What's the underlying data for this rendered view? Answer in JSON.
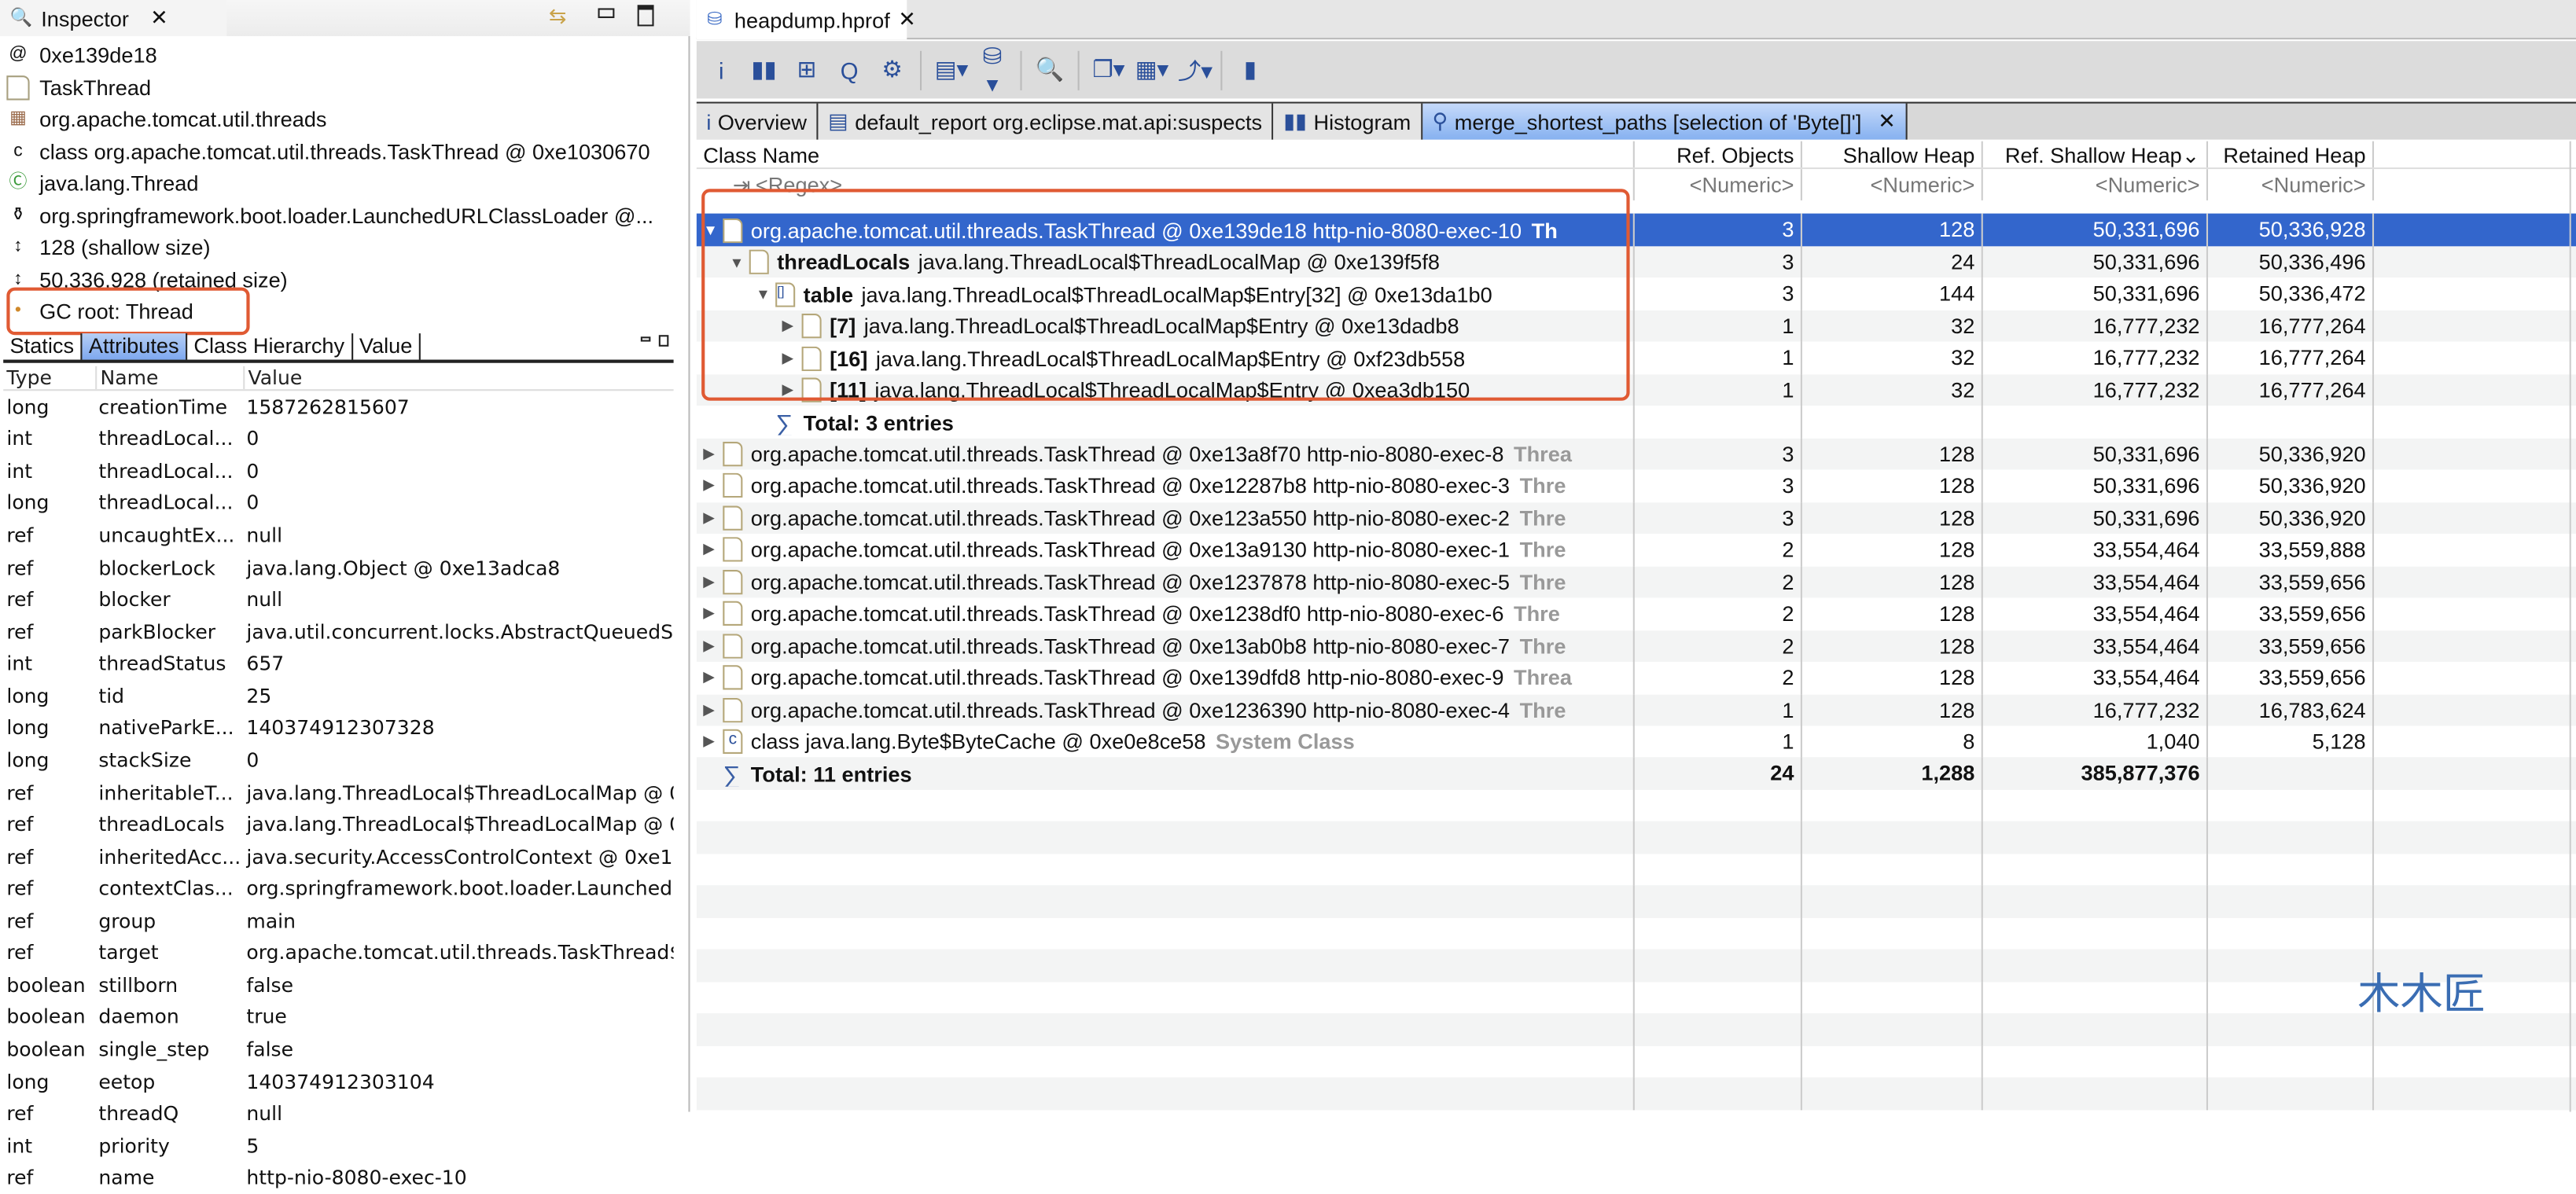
{
  "inspector": {
    "title": "Inspector",
    "info": [
      {
        "icon": "address-icon",
        "text": "0xe139de18"
      },
      {
        "icon": "object-icon",
        "text": "TaskThread"
      },
      {
        "icon": "package-icon",
        "text": "org.apache.tomcat.util.threads"
      },
      {
        "icon": "class-icon",
        "text": "class org.apache.tomcat.util.threads.TaskThread @ 0xe1030670"
      },
      {
        "icon": "superclass-icon",
        "text": "java.lang.Thread"
      },
      {
        "icon": "classloader-icon",
        "text": "org.springframework.boot.loader.LaunchedURLClassLoader @..."
      },
      {
        "icon": "shallow-size-icon",
        "text": "128 (shallow size)"
      },
      {
        "icon": "retained-size-icon",
        "text": "50,336,928 (retained size)"
      },
      {
        "icon": "gc-root-icon",
        "text": "GC root: Thread"
      }
    ],
    "tabs": [
      "Statics",
      "Attributes",
      "Class Hierarchy",
      "Value"
    ],
    "active_tab": "Attributes",
    "columns": [
      "Type",
      "Name",
      "Value"
    ],
    "rows": [
      [
        "long",
        "creationTime",
        "1587262815607"
      ],
      [
        "int",
        "threadLocal...",
        "0"
      ],
      [
        "int",
        "threadLocal...",
        "0"
      ],
      [
        "long",
        "threadLocal...",
        "0"
      ],
      [
        "ref",
        "uncaughtEx...",
        "null"
      ],
      [
        "ref",
        "blockerLock",
        "java.lang.Object @ 0xe13adca8"
      ],
      [
        "ref",
        "blocker",
        "null"
      ],
      [
        "ref",
        "parkBlocker",
        "java.util.concurrent.locks.AbstractQueuedS"
      ],
      [
        "int",
        "threadStatus",
        "657"
      ],
      [
        "long",
        "tid",
        "25"
      ],
      [
        "long",
        "nativeParkE...",
        "140374912307328"
      ],
      [
        "long",
        "stackSize",
        "0"
      ],
      [
        "ref",
        "inheritableT...",
        "java.lang.ThreadLocal$ThreadLocalMap @ 0"
      ],
      [
        "ref",
        "threadLocals",
        "java.lang.ThreadLocal$ThreadLocalMap @ 0"
      ],
      [
        "ref",
        "inheritedAcc...",
        "java.security.AccessControlContext @ 0xe1"
      ],
      [
        "ref",
        "contextClas...",
        "org.springframework.boot.loader.Launched"
      ],
      [
        "ref",
        "group",
        "main"
      ],
      [
        "ref",
        "target",
        "org.apache.tomcat.util.threads.TaskThread$"
      ],
      [
        "boolean",
        "stillborn",
        "false"
      ],
      [
        "boolean",
        "daemon",
        "true"
      ],
      [
        "boolean",
        "single_step",
        "false"
      ],
      [
        "long",
        "eetop",
        "140374912303104"
      ],
      [
        "ref",
        "threadQ",
        "null"
      ],
      [
        "int",
        "priority",
        "5"
      ],
      [
        "ref",
        "name",
        "http-nio-8080-exec-10"
      ]
    ]
  },
  "editor": {
    "tab": "heapdump.hprof",
    "toolbar": [
      "info-icon",
      "histogram-icon",
      "dominator-tree-icon",
      "oql-icon",
      "query-icon",
      "report-icon",
      "heap-query-icon",
      "search-icon",
      "group-icon",
      "calculator-icon",
      "export-icon",
      "leak-icon"
    ],
    "query_tabs": [
      "Overview",
      "default_report  org.eclipse.mat.api:suspects",
      "Histogram",
      "merge_shortest_paths  [selection of 'Byte[]']"
    ],
    "active_query_tab": 3,
    "columns": [
      "Class Name",
      "Ref. Objects",
      "Shallow Heap",
      "Ref. Shallow Heap",
      "Retained Heap"
    ],
    "sort_indicator": "⌄",
    "filter": {
      "regex": "<Regex>",
      "numeric": "<Numeric>"
    },
    "rows": [
      {
        "level": 0,
        "exp": "open",
        "icon": "thread-object-icon",
        "bold": "",
        "name": "org.apache.tomcat.util.threads.TaskThread @ 0xe139de18  http-nio-8080-exec-10",
        "suffix": "Th",
        "v": [
          "3",
          "128",
          "50,331,696",
          "50,336,928"
        ],
        "selected": true
      },
      {
        "level": 1,
        "exp": "open",
        "icon": "object-icon",
        "bold": "threadLocals",
        "name": "java.lang.ThreadLocal$ThreadLocalMap @ 0xe139f5f8",
        "suffix": "",
        "v": [
          "3",
          "24",
          "50,331,696",
          "50,336,496"
        ]
      },
      {
        "level": 2,
        "exp": "open",
        "icon": "array-icon",
        "bold": "table",
        "name": "java.lang.ThreadLocal$ThreadLocalMap$Entry[32] @ 0xe13da1b0",
        "suffix": "",
        "v": [
          "3",
          "144",
          "50,331,696",
          "50,336,472"
        ]
      },
      {
        "level": 3,
        "exp": "closed",
        "icon": "object-icon",
        "bold": "[7]",
        "name": "java.lang.ThreadLocal$ThreadLocalMap$Entry @ 0xe13dadb8",
        "suffix": "",
        "v": [
          "1",
          "32",
          "16,777,232",
          "16,777,264"
        ]
      },
      {
        "level": 3,
        "exp": "closed",
        "icon": "object-icon",
        "bold": "[16]",
        "name": "java.lang.ThreadLocal$ThreadLocalMap$Entry @ 0xf23db558",
        "suffix": "",
        "v": [
          "1",
          "32",
          "16,777,232",
          "16,777,264"
        ]
      },
      {
        "level": 3,
        "exp": "closed",
        "icon": "object-icon",
        "bold": "[11]",
        "name": "java.lang.ThreadLocal$ThreadLocalMap$Entry @ 0xea3db150",
        "suffix": "",
        "v": [
          "1",
          "32",
          "16,777,232",
          "16,777,264"
        ]
      },
      {
        "level": 2,
        "exp": "",
        "icon": "sum-icon",
        "bold": "Total: 3 entries",
        "name": "",
        "suffix": "",
        "v": [
          "",
          "",
          "",
          ""
        ]
      },
      {
        "level": 0,
        "exp": "closed",
        "icon": "thread-object-icon",
        "bold": "",
        "name": "org.apache.tomcat.util.threads.TaskThread @ 0xe13a8f70  http-nio-8080-exec-8",
        "suffix": "Threa",
        "v": [
          "3",
          "128",
          "50,331,696",
          "50,336,920"
        ]
      },
      {
        "level": 0,
        "exp": "closed",
        "icon": "thread-object-icon",
        "bold": "",
        "name": "org.apache.tomcat.util.threads.TaskThread @ 0xe12287b8  http-nio-8080-exec-3",
        "suffix": "Thre",
        "v": [
          "3",
          "128",
          "50,331,696",
          "50,336,920"
        ]
      },
      {
        "level": 0,
        "exp": "closed",
        "icon": "thread-object-icon",
        "bold": "",
        "name": "org.apache.tomcat.util.threads.TaskThread @ 0xe123a550  http-nio-8080-exec-2",
        "suffix": "Thre",
        "v": [
          "3",
          "128",
          "50,331,696",
          "50,336,920"
        ]
      },
      {
        "level": 0,
        "exp": "closed",
        "icon": "thread-object-icon",
        "bold": "",
        "name": "org.apache.tomcat.util.threads.TaskThread @ 0xe13a9130  http-nio-8080-exec-1",
        "suffix": "Thre",
        "v": [
          "2",
          "128",
          "33,554,464",
          "33,559,888"
        ]
      },
      {
        "level": 0,
        "exp": "closed",
        "icon": "thread-object-icon",
        "bold": "",
        "name": "org.apache.tomcat.util.threads.TaskThread @ 0xe1237878  http-nio-8080-exec-5",
        "suffix": "Thre",
        "v": [
          "2",
          "128",
          "33,554,464",
          "33,559,656"
        ]
      },
      {
        "level": 0,
        "exp": "closed",
        "icon": "thread-object-icon",
        "bold": "",
        "name": "org.apache.tomcat.util.threads.TaskThread @ 0xe1238df0  http-nio-8080-exec-6",
        "suffix": "Thre",
        "v": [
          "2",
          "128",
          "33,554,464",
          "33,559,656"
        ]
      },
      {
        "level": 0,
        "exp": "closed",
        "icon": "thread-object-icon",
        "bold": "",
        "name": "org.apache.tomcat.util.threads.TaskThread @ 0xe13ab0b8  http-nio-8080-exec-7",
        "suffix": "Thre",
        "v": [
          "2",
          "128",
          "33,554,464",
          "33,559,656"
        ]
      },
      {
        "level": 0,
        "exp": "closed",
        "icon": "thread-object-icon",
        "bold": "",
        "name": "org.apache.tomcat.util.threads.TaskThread @ 0xe139dfd8  http-nio-8080-exec-9",
        "suffix": "Threa",
        "v": [
          "2",
          "128",
          "33,554,464",
          "33,559,656"
        ]
      },
      {
        "level": 0,
        "exp": "closed",
        "icon": "thread-object-icon",
        "bold": "",
        "name": "org.apache.tomcat.util.threads.TaskThread @ 0xe1236390  http-nio-8080-exec-4",
        "suffix": "Thre",
        "v": [
          "1",
          "128",
          "16,777,232",
          "16,783,624"
        ]
      },
      {
        "level": 0,
        "exp": "closed",
        "icon": "class-icon",
        "bold": "",
        "name": "class java.lang.Byte$ByteCache @ 0xe0e8ce58",
        "suffix": "System Class",
        "v": [
          "1",
          "8",
          "1,040",
          "5,128"
        ]
      },
      {
        "level": 0,
        "exp": "",
        "icon": "sum-icon",
        "bold": "Total: 11 entries",
        "name": "",
        "suffix": "",
        "v": [
          "24",
          "1,288",
          "385,877,376",
          ""
        ],
        "total": true
      }
    ]
  },
  "watermark": "木木匠",
  "colors": {
    "selection": "#3366cc",
    "highlight_box": "#e05a33",
    "watermark": "#3a6db3"
  }
}
